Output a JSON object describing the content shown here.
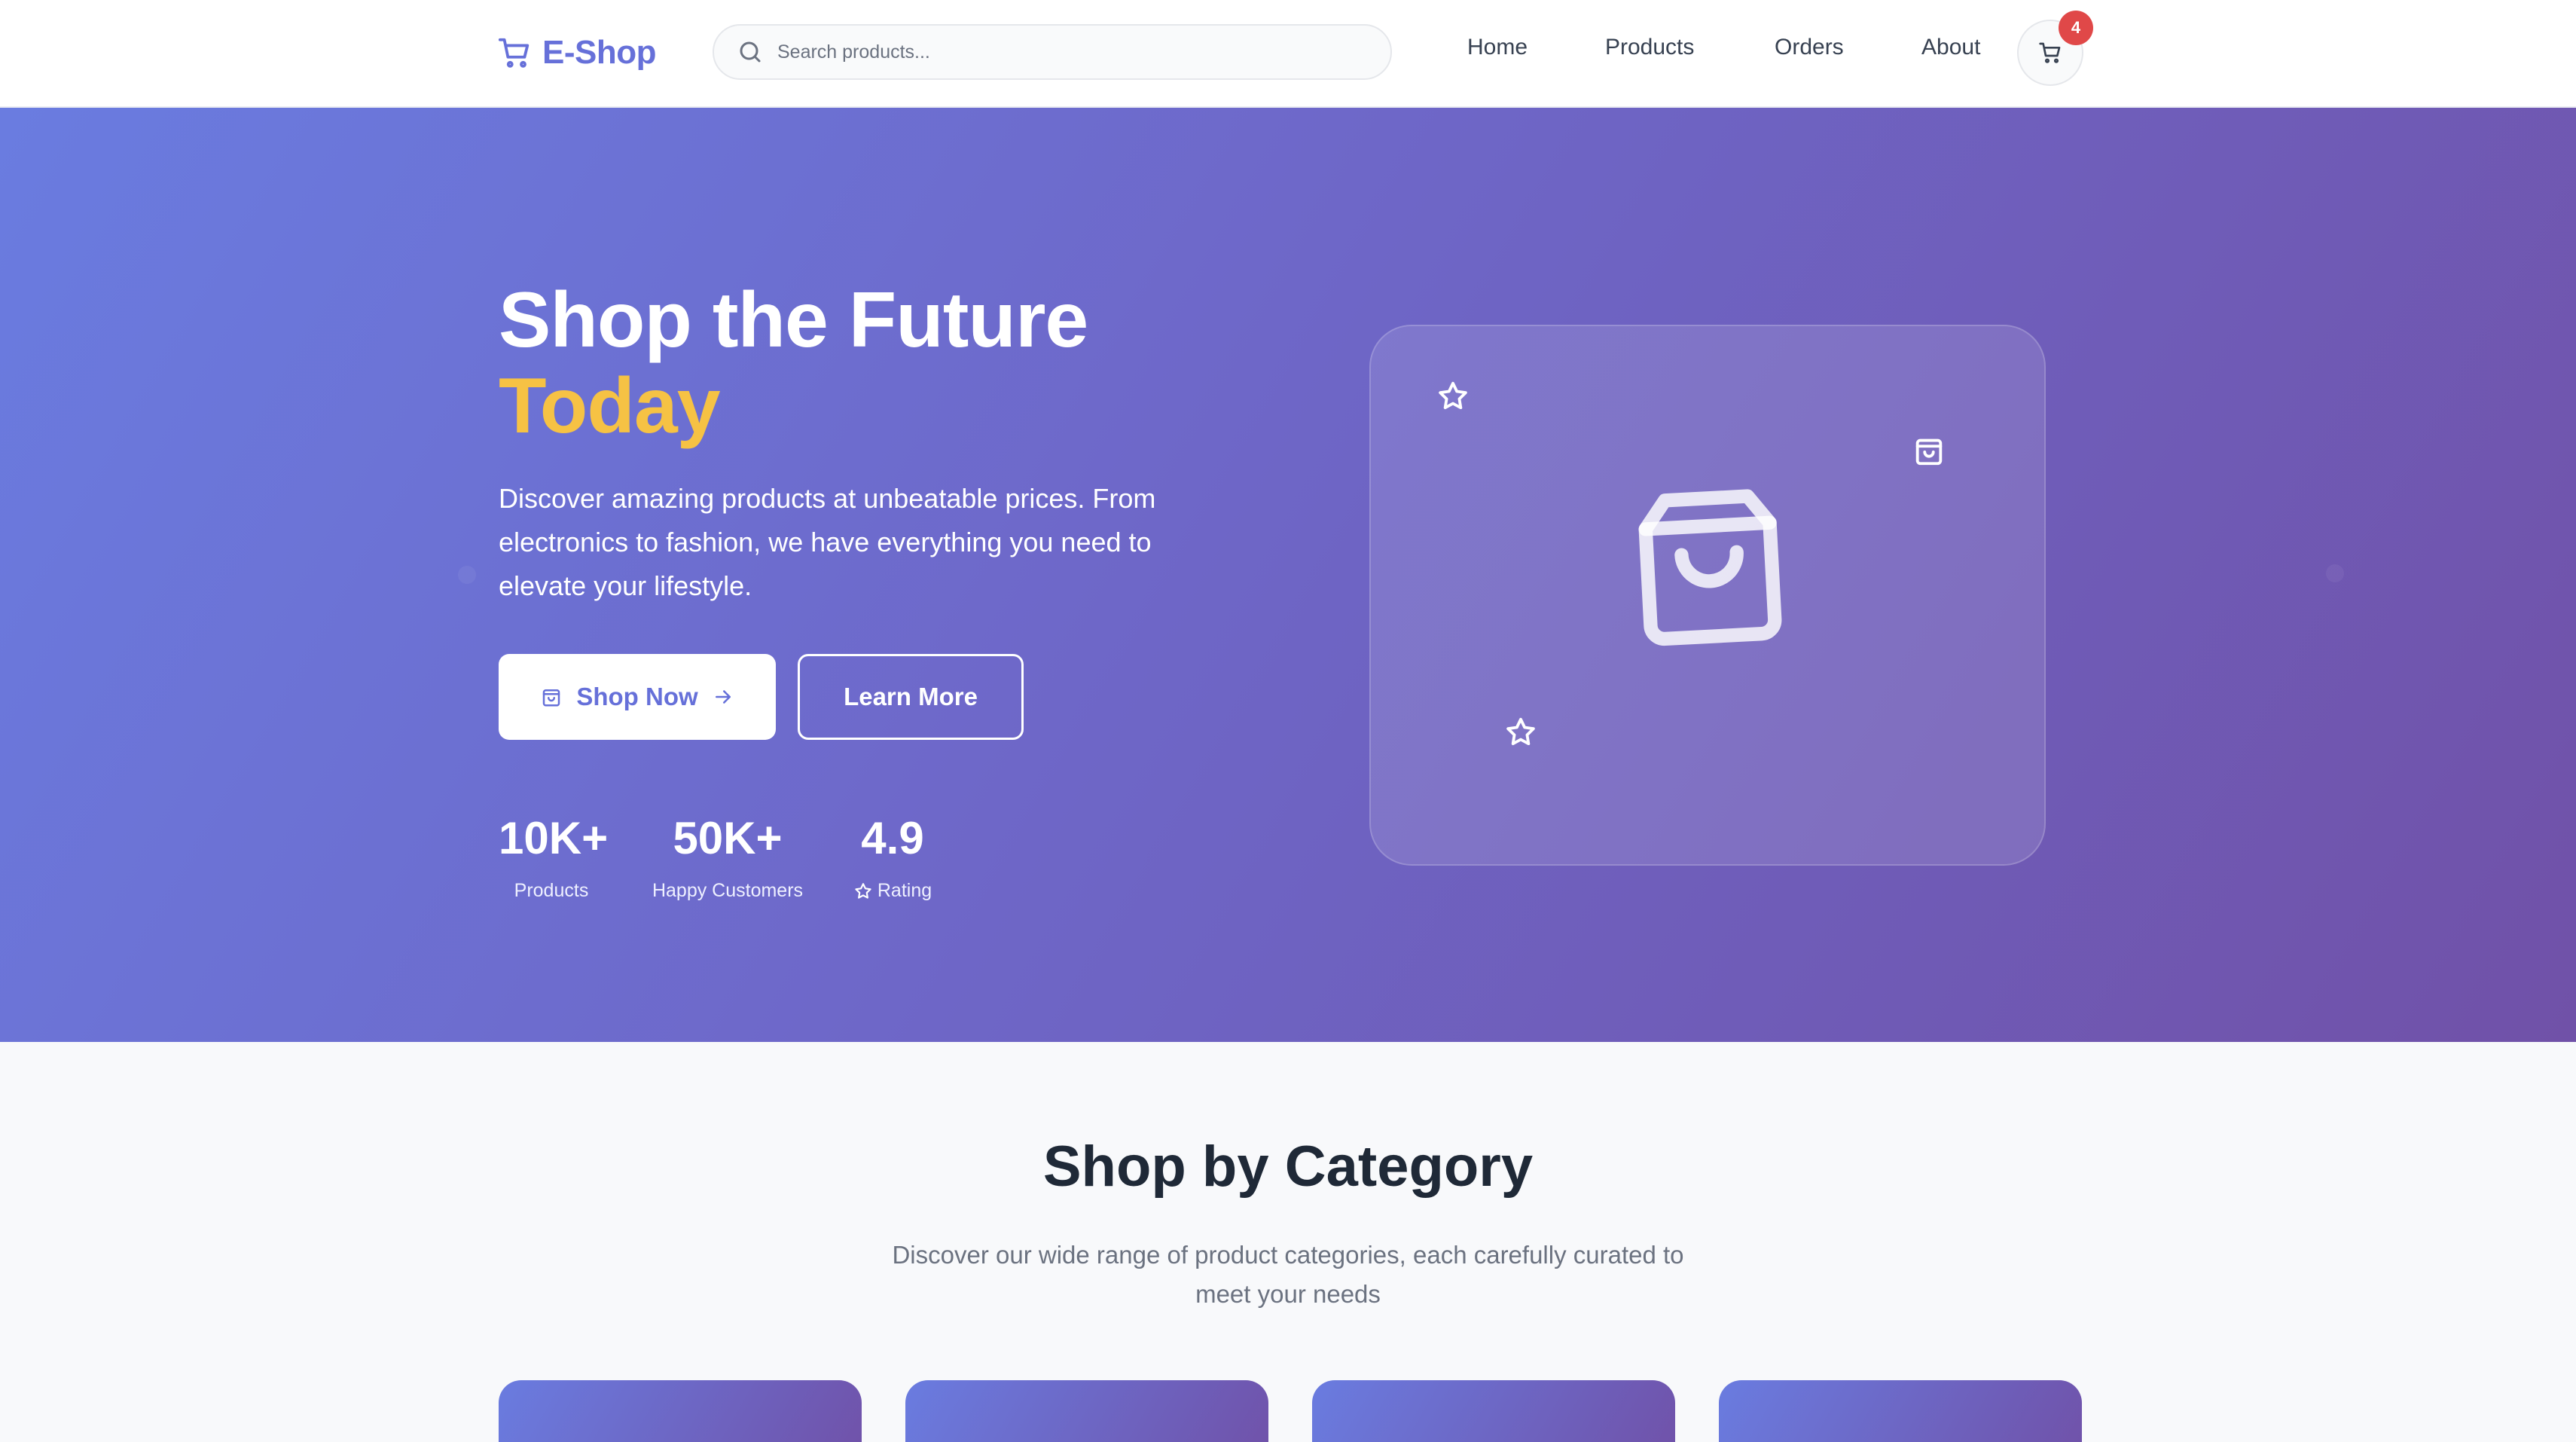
{
  "header": {
    "brand": "E-Shop",
    "search_placeholder": "Search products...",
    "nav": [
      "Home",
      "Products",
      "Orders",
      "About"
    ],
    "cart_count": "4"
  },
  "hero": {
    "title_line1": "Shop the Future",
    "title_line2": "Today",
    "description": "Discover amazing products at unbeatable prices. From electronics to fashion, we have everything you need to elevate your lifestyle.",
    "primary_button": "Shop Now",
    "secondary_button": "Learn More",
    "stats": [
      {
        "value": "10K+",
        "label": "Products"
      },
      {
        "value": "50K+",
        "label": "Happy Customers"
      },
      {
        "value": "4.9",
        "label": "Rating"
      }
    ]
  },
  "categories": {
    "title": "Shop by Category",
    "subtitle": "Discover our wide range of product categories, each carefully curated to meet your needs"
  },
  "colors": {
    "brand": "#6670d9",
    "hero_gradient_start": "#6a7ce0",
    "hero_gradient_end": "#7051a8",
    "accent": "#f6c244",
    "badge": "#e04848"
  }
}
